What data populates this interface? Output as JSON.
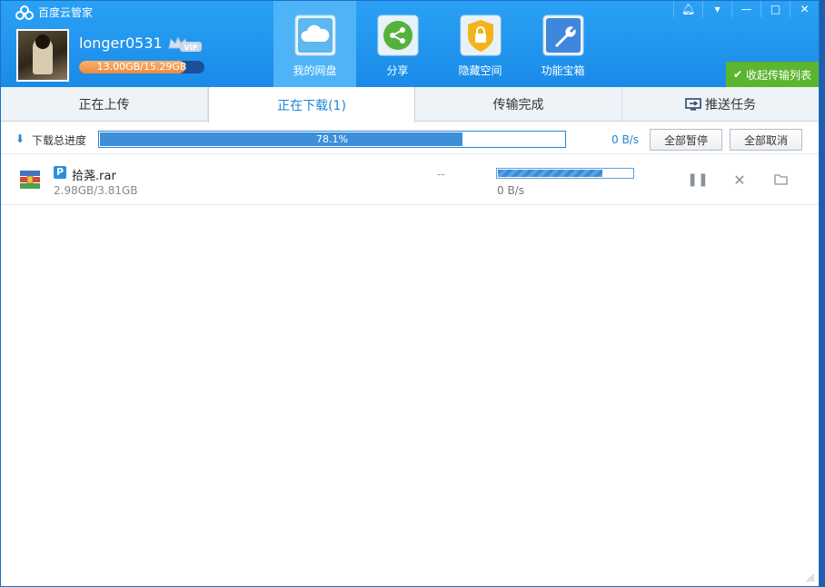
{
  "app": {
    "title": "百度云管家"
  },
  "user": {
    "name": "longer0531",
    "badge": "VIP",
    "quota_text": "13.00GB/15.29GB",
    "quota_used_fraction": 0.85
  },
  "nav": [
    {
      "label": "我的网盘",
      "icon": "cloud-icon",
      "active": true
    },
    {
      "label": "分享",
      "icon": "share-icon",
      "active": false
    },
    {
      "label": "隐藏空间",
      "icon": "lock-icon",
      "active": false
    },
    {
      "label": "功能宝箱",
      "icon": "wrench-icon",
      "active": false
    }
  ],
  "window_controls": [
    "bell-icon",
    "dropdown-icon",
    "minimize-icon",
    "maximize-icon",
    "close-icon"
  ],
  "collapse_label": "收起传输列表",
  "tabs": [
    {
      "label": "正在上传",
      "active": false
    },
    {
      "label": "正在下载(1)",
      "active": true
    },
    {
      "label": "传输完成",
      "active": false
    },
    {
      "label": "推送任务",
      "active": false,
      "icon": "monitor-push-icon"
    }
  ],
  "total": {
    "label": "下载总进度",
    "percent_text": "78.1%",
    "percent": 78.1,
    "speed": "0 B/s",
    "pause_all": "全部暂停",
    "cancel_all": "全部取消"
  },
  "files": [
    {
      "name": "拾荛.rar",
      "size": "2.98GB/3.81GB",
      "eta": "--",
      "speed": "0 B/s",
      "progress": 0.78,
      "type_icon": "rar-archive-icon"
    }
  ],
  "colors": {
    "header": "#1a8be8",
    "accent": "#1a86d6",
    "green": "#5bb52f",
    "progress": "#3d8fd8"
  }
}
